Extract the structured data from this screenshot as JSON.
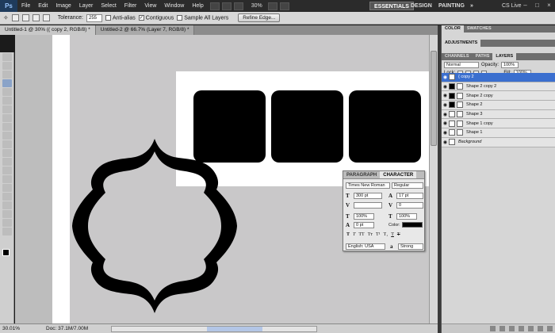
{
  "app": {
    "logo": "Ps",
    "menu": [
      "File",
      "Edit",
      "Image",
      "Layer",
      "Select",
      "Filter",
      "View",
      "Window",
      "Help"
    ],
    "zoom": "30%",
    "workspaces": {
      "essentials": "ESSENTIALS",
      "design": "DESIGN",
      "painting": "PAINTING",
      "more": "»"
    },
    "cslive": "CS Live"
  },
  "options": {
    "tolerance_label": "Tolerance:",
    "tolerance_value": "255",
    "antialias_label": "Anti-alias",
    "contiguous_label": "Contiguous",
    "sample_all_label": "Sample All Layers",
    "refine_edge_label": "Refine Edge..."
  },
  "doc_tabs": [
    {
      "label": "Untitled-1 @ 30% (( copy 2, RGB/8) *"
    },
    {
      "label": "Untitled-2 @ 66.7% (Layer 7, RGB/8) *"
    }
  ],
  "status": {
    "zoom": "30.01%",
    "doc": "Doc: 37.1M/7.00M"
  },
  "character_panel": {
    "tabs": [
      "PARAGRAPH",
      "CHARACTER"
    ],
    "font_family": "Times New Roman",
    "font_style": "Regular",
    "size": "300 pt",
    "leading": "17 pt",
    "tracking": "0",
    "vscale": "100%",
    "hscale": "100%",
    "baseline": "0 pt",
    "color_label": "Color:",
    "language": "English: USA",
    "antialias": "Strong",
    "color": "#000000"
  },
  "panels": {
    "color_tabs": [
      "COLOR",
      "SWATCHES"
    ],
    "adjustments": "ADJUSTMENTS",
    "layer_tabs": [
      "CHANNELS",
      "PATHS",
      "LAYERS"
    ],
    "blend_mode": "Normal",
    "opacity_label": "Opacity:",
    "opacity": "100%",
    "lock_label": "Lock:",
    "fill_label": "Fill:",
    "fill": "100%"
  },
  "layers": [
    {
      "name": "{ copy 2",
      "selected": true
    },
    {
      "name": "Shape 2 copy 2",
      "selected": false
    },
    {
      "name": "Shape 2 copy",
      "selected": false
    },
    {
      "name": "Shape 2",
      "selected": false
    },
    {
      "name": "Shape 3",
      "selected": false
    },
    {
      "name": "Shape 1 copy",
      "selected": false
    },
    {
      "name": "Shape 1",
      "selected": false
    },
    {
      "name": "Background",
      "selected": false
    }
  ]
}
